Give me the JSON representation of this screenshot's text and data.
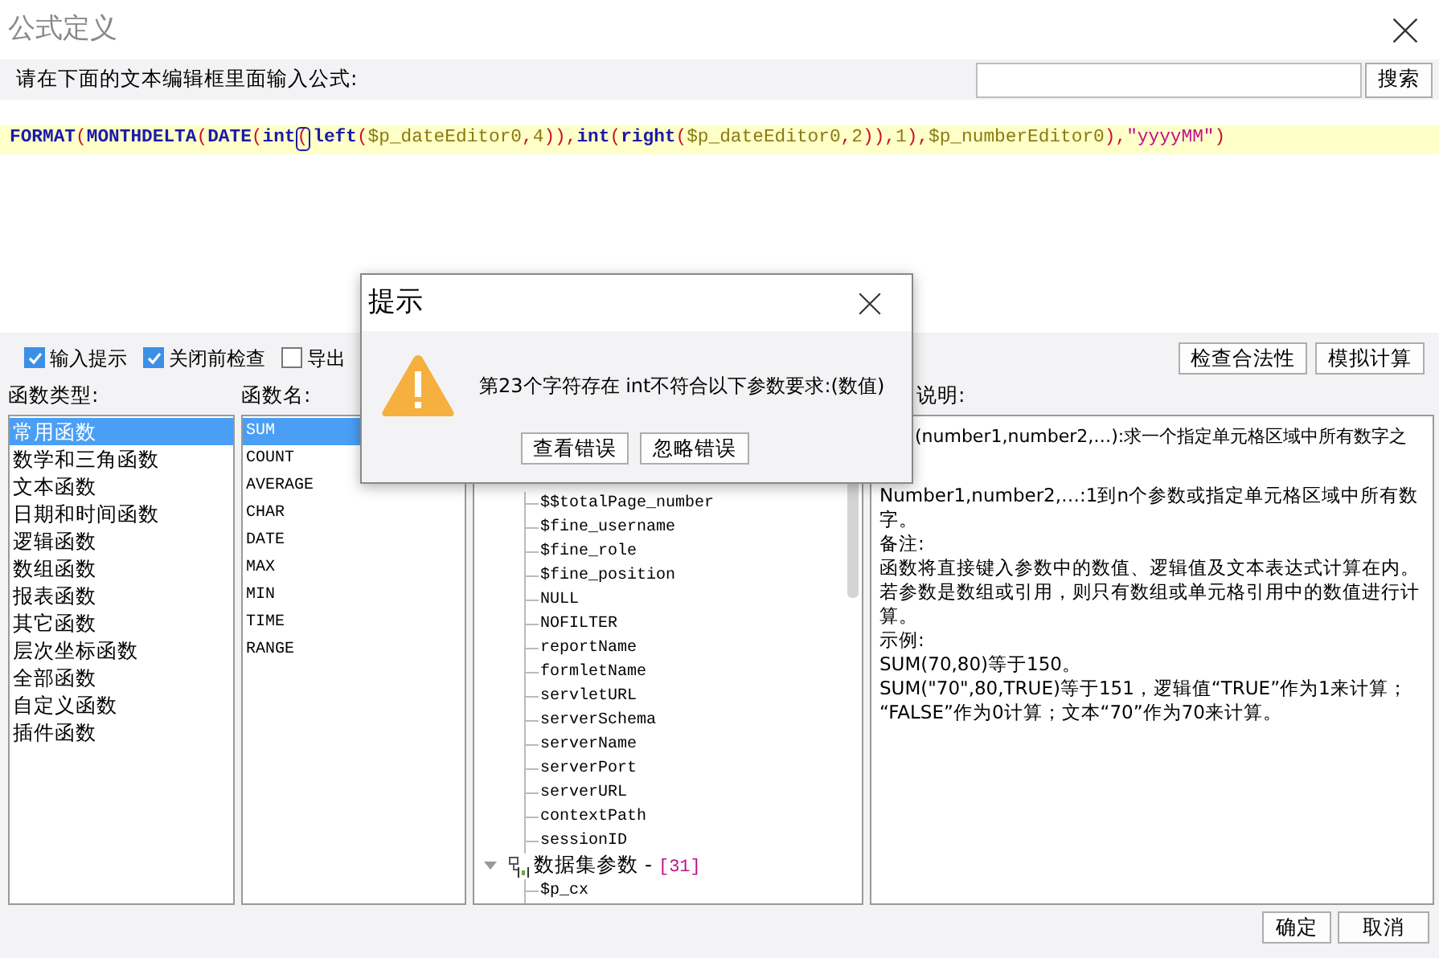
{
  "window": {
    "title": "公式定义"
  },
  "prompt": "请在下面的文本编辑框里面输入公式:",
  "search": {
    "button": "搜索"
  },
  "formula": [
    {
      "text": "FORMAT",
      "kind": "function"
    },
    {
      "text": "(",
      "kind": "paren"
    },
    {
      "text": "MONTHDELTA",
      "kind": "function"
    },
    {
      "text": "(",
      "kind": "paren"
    },
    {
      "text": "DATE",
      "kind": "function"
    },
    {
      "text": "(",
      "kind": "paren"
    },
    {
      "text": "int",
      "kind": "function"
    },
    {
      "text": "(",
      "kind": "caret_paren"
    },
    {
      "text": "left",
      "kind": "function"
    },
    {
      "text": "(",
      "kind": "paren"
    },
    {
      "text": "$p_dateEditor0",
      "kind": "param"
    },
    {
      "text": ",",
      "kind": "paren"
    },
    {
      "text": "4",
      "kind": "number"
    },
    {
      "text": "))",
      "kind": "paren"
    },
    {
      "text": ",",
      "kind": "paren"
    },
    {
      "text": "int",
      "kind": "function"
    },
    {
      "text": "(",
      "kind": "paren"
    },
    {
      "text": "right",
      "kind": "function"
    },
    {
      "text": "(",
      "kind": "paren"
    },
    {
      "text": "$p_dateEditor0",
      "kind": "param"
    },
    {
      "text": ",",
      "kind": "paren"
    },
    {
      "text": "2",
      "kind": "number"
    },
    {
      "text": ")),",
      "kind": "paren"
    },
    {
      "text": "1",
      "kind": "number"
    },
    {
      "text": "),",
      "kind": "paren"
    },
    {
      "text": "$p_numberEditor0",
      "kind": "param"
    },
    {
      "text": "),",
      "kind": "paren"
    },
    {
      "text": "\"yyyyMM\"",
      "kind": "string"
    },
    {
      "text": ")",
      "kind": "paren"
    }
  ],
  "options": [
    {
      "label": "输入提示",
      "checked": true
    },
    {
      "label": "关闭前检查",
      "checked": true
    },
    {
      "label": "导出",
      "checked": false
    }
  ],
  "actions": [
    "检查合法性",
    "模拟计算"
  ],
  "function_types": {
    "label": "函数类型:",
    "items": [
      {
        "label": "常用函数",
        "selected": true
      },
      {
        "label": "数学和三角函数",
        "selected": false
      },
      {
        "label": "文本函数",
        "selected": false
      },
      {
        "label": "日期和时间函数",
        "selected": false
      },
      {
        "label": "逻辑函数",
        "selected": false
      },
      {
        "label": "数组函数",
        "selected": false
      },
      {
        "label": "报表函数",
        "selected": false
      },
      {
        "label": "其它函数",
        "selected": false
      },
      {
        "label": "层次坐标函数",
        "selected": false
      },
      {
        "label": "全部函数",
        "selected": false
      },
      {
        "label": "自定义函数",
        "selected": false
      },
      {
        "label": "插件函数",
        "selected": false
      }
    ]
  },
  "function_names": {
    "label": "函数名:",
    "items": [
      {
        "label": "SUM",
        "selected": true
      },
      {
        "label": "COUNT",
        "selected": false
      },
      {
        "label": "AVERAGE",
        "selected": false
      },
      {
        "label": "CHAR",
        "selected": false
      },
      {
        "label": "DATE",
        "selected": false
      },
      {
        "label": "MAX",
        "selected": false
      },
      {
        "label": "MIN",
        "selected": false
      },
      {
        "label": "TIME",
        "selected": false
      },
      {
        "label": "RANGE",
        "selected": false
      }
    ]
  },
  "tree": {
    "items": [
      "$$totalPage_number",
      "$fine_username",
      "$fine_role",
      "$fine_position",
      "NULL",
      "NOFILTER",
      "reportName",
      "formletName",
      "servletURL",
      "serverSchema",
      "serverName",
      "serverPort",
      "serverURL",
      "contextPath",
      "sessionID"
    ],
    "groups": [
      {
        "label": "数据集参数 -",
        "count": "[31]",
        "expanded": true,
        "children": [
          "$p_cx"
        ]
      }
    ]
  },
  "description": {
    "label": "说明:",
    "first_line": "(number1,number2,…):求一个指定单元格区域中所有数字之",
    "lines": [
      "Number1,number2,…:1到n个参数或指定单元格区域中所有数",
      "字。",
      "备注:",
      "函数将直接键入参数中的数值、逻辑值及文本表达式计算在内。",
      "若参数是数组或引用，则只有数组或单元格引用中的数值进行计",
      "算。",
      "示例:",
      "SUM(70,80)等于150。",
      "SUM(\"70\",80,TRUE)等于151，逻辑值“TRUE”作为1来计算；",
      "“FALSE”作为0计算；文本“70”作为70来计算。"
    ]
  },
  "footer": [
    "确定",
    "取消"
  ],
  "dialog": {
    "title": "提示",
    "message": "第23个字符存在 int不符合以下参数要求:(数值)",
    "buttons": [
      "查看错误",
      "忽略错误"
    ]
  }
}
